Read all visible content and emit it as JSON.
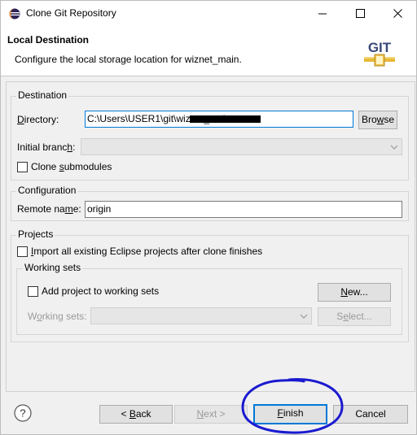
{
  "window": {
    "title": "Clone Git Repository"
  },
  "header": {
    "title": "Local Destination",
    "description": "Configure the local storage location for wiznet_main.",
    "logo_text": "GIT"
  },
  "destination": {
    "group_label": "Destination",
    "directory_label_pre": "",
    "directory_label_u": "D",
    "directory_label_post": "irectory:",
    "directory_value": "C:\\Users\\USER1\\git\\wiznet_main",
    "browse_label_pre": "Bro",
    "browse_label_u": "w",
    "browse_label_post": "se",
    "initial_branch_label_pre": "Initial branc",
    "initial_branch_label_u": "h",
    "initial_branch_label_post": ":",
    "initial_branch_value": "",
    "clone_submodules_pre": "Clone ",
    "clone_submodules_u": "s",
    "clone_submodules_post": "ubmodules",
    "clone_submodules_checked": false
  },
  "configuration": {
    "group_label": "Configuration",
    "remote_label_pre": "Remote na",
    "remote_label_u": "m",
    "remote_label_post": "e:",
    "remote_value": "origin"
  },
  "projects": {
    "group_label": "Projects",
    "import_pre": "",
    "import_u": "I",
    "import_post": "mport all existing Eclipse projects after clone finishes",
    "import_checked": false,
    "working_sets_group_label": "Working sets",
    "add_to_ws_pre": "Add pro",
    "add_to_ws_u": "j",
    "add_to_ws_post": "ect to working sets",
    "add_to_ws_checked": false,
    "new_btn_pre": "",
    "new_btn_u": "N",
    "new_btn_post": "ew...",
    "ws_label_pre": "W",
    "ws_label_u": "o",
    "ws_label_post": "rking sets:",
    "select_btn_pre": "S",
    "select_btn_u": "e",
    "select_btn_post": "lect..."
  },
  "footer": {
    "back_pre": "< ",
    "back_u": "B",
    "back_post": "ack",
    "next_pre": "",
    "next_u": "N",
    "next_post": "ext >",
    "finish_pre": "",
    "finish_u": "F",
    "finish_post": "inish",
    "cancel_label": "Cancel"
  },
  "colors": {
    "accent": "#0078d7",
    "annotation": "#1a1ad0"
  }
}
